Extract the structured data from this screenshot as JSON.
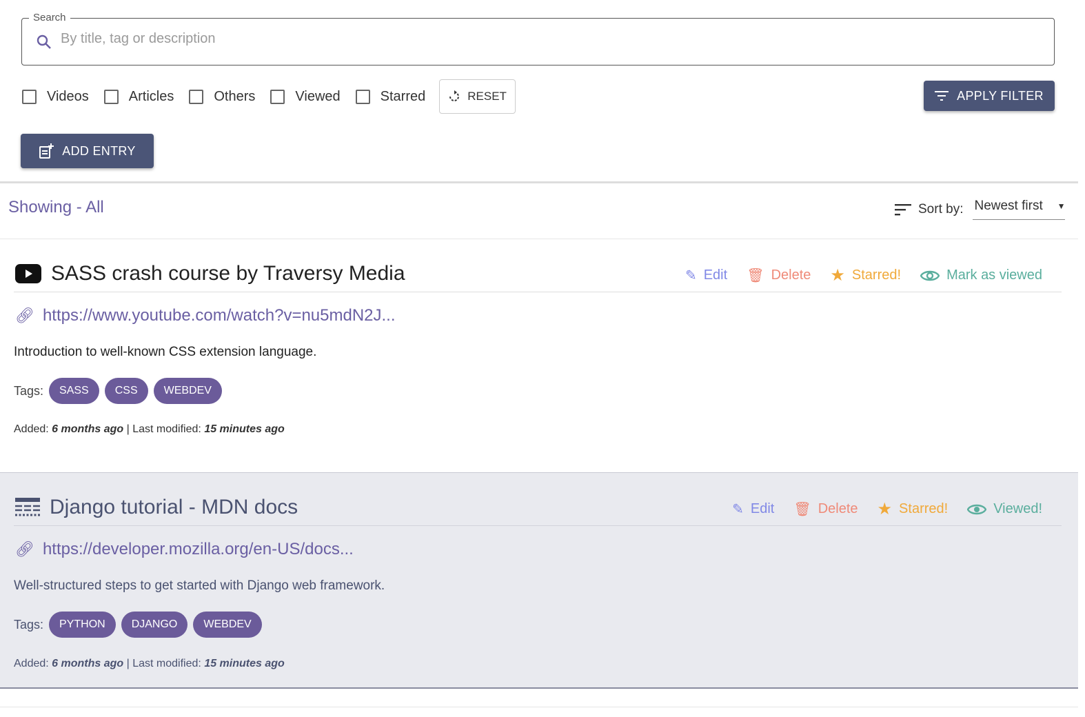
{
  "search": {
    "label": "Search",
    "placeholder": "By title, tag or description"
  },
  "filters": [
    {
      "label": "Videos",
      "checked": false
    },
    {
      "label": "Articles",
      "checked": false
    },
    {
      "label": "Others",
      "checked": false
    },
    {
      "label": "Viewed",
      "checked": false
    },
    {
      "label": "Starred",
      "checked": false
    }
  ],
  "reset_label": "RESET",
  "apply_label": "APPLY FILTER",
  "add_label": "ADD ENTRY",
  "showing": "Showing - All",
  "sort": {
    "label": "Sort by:",
    "value": "Newest first"
  },
  "entries": [
    {
      "type": "video",
      "title": "SASS crash course by Traversy Media",
      "url": "https://www.youtube.com/watch?v=nu5mdN2J...",
      "description": "Introduction to well-known CSS extension language.",
      "tags_label": "Tags:",
      "tags": [
        "SASS",
        "CSS",
        "WEBDEV"
      ],
      "added_label": "Added:",
      "added": "6 months ago",
      "modified_label": "| Last modified:",
      "modified": "15 minutes ago",
      "edit": "Edit",
      "delete": "Delete",
      "star": "Starred!",
      "view": "Mark as viewed"
    },
    {
      "type": "article",
      "title": "Django tutorial - MDN docs",
      "url": "https://developer.mozilla.org/en-US/docs...",
      "description": "Well-structured steps to get started with Django web framework.",
      "tags_label": "Tags:",
      "tags": [
        "PYTHON",
        "DJANGO",
        "WEBDEV"
      ],
      "added_label": "Added:",
      "added": "6 months ago",
      "modified_label": "| Last modified:",
      "modified": "15 minutes ago",
      "edit": "Edit",
      "delete": "Delete",
      "star": "Starred!",
      "view": "Viewed!"
    }
  ],
  "colors": {
    "primary": "#4b5577",
    "accent": "#6a5fa3",
    "edit": "#8088e6",
    "delete": "#ef8a78",
    "star": "#f0a93a",
    "view": "#5aae9d"
  }
}
